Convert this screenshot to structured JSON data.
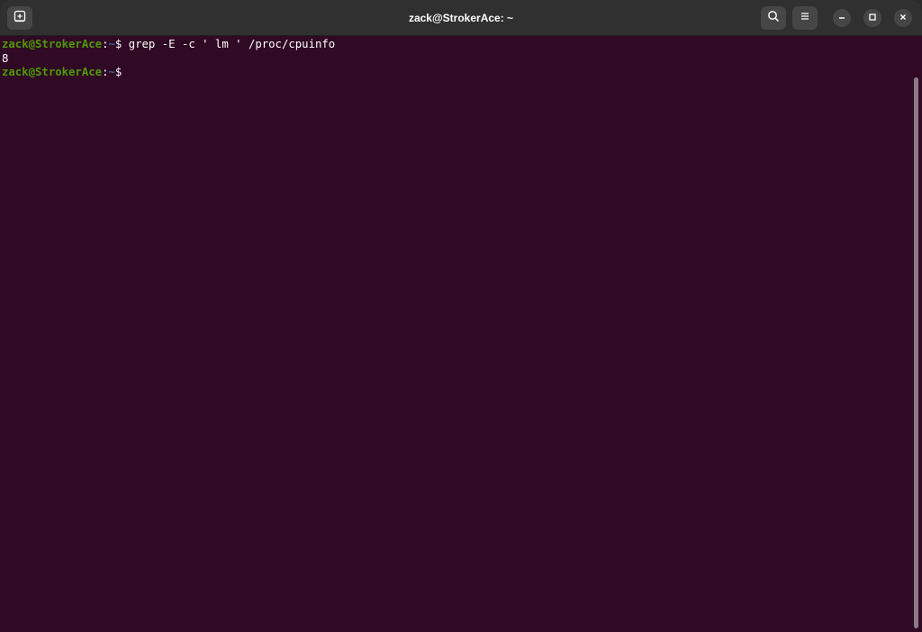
{
  "window": {
    "title": "zack@StrokerAce: ~"
  },
  "icons": {
    "new_tab": "new-tab-icon",
    "search": "search-icon",
    "menu": "hamburger-menu-icon",
    "minimize": "minimize-icon",
    "maximize": "maximize-icon",
    "close": "close-icon"
  },
  "terminal": {
    "lines": [
      {
        "user_host": "zack@StrokerAce",
        "sep": ":",
        "path": "~",
        "prompt": "$ ",
        "command": "grep -E -c ' lm ' /proc/cpuinfo"
      },
      {
        "output": "8"
      },
      {
        "user_host": "zack@StrokerAce",
        "sep": ":",
        "path": "~",
        "prompt": "$ ",
        "command": ""
      }
    ]
  },
  "colors": {
    "background": "#300a24",
    "titlebar": "#303030",
    "user_host": "#4e9a06",
    "path": "#3465a4",
    "text": "#ffffff"
  }
}
